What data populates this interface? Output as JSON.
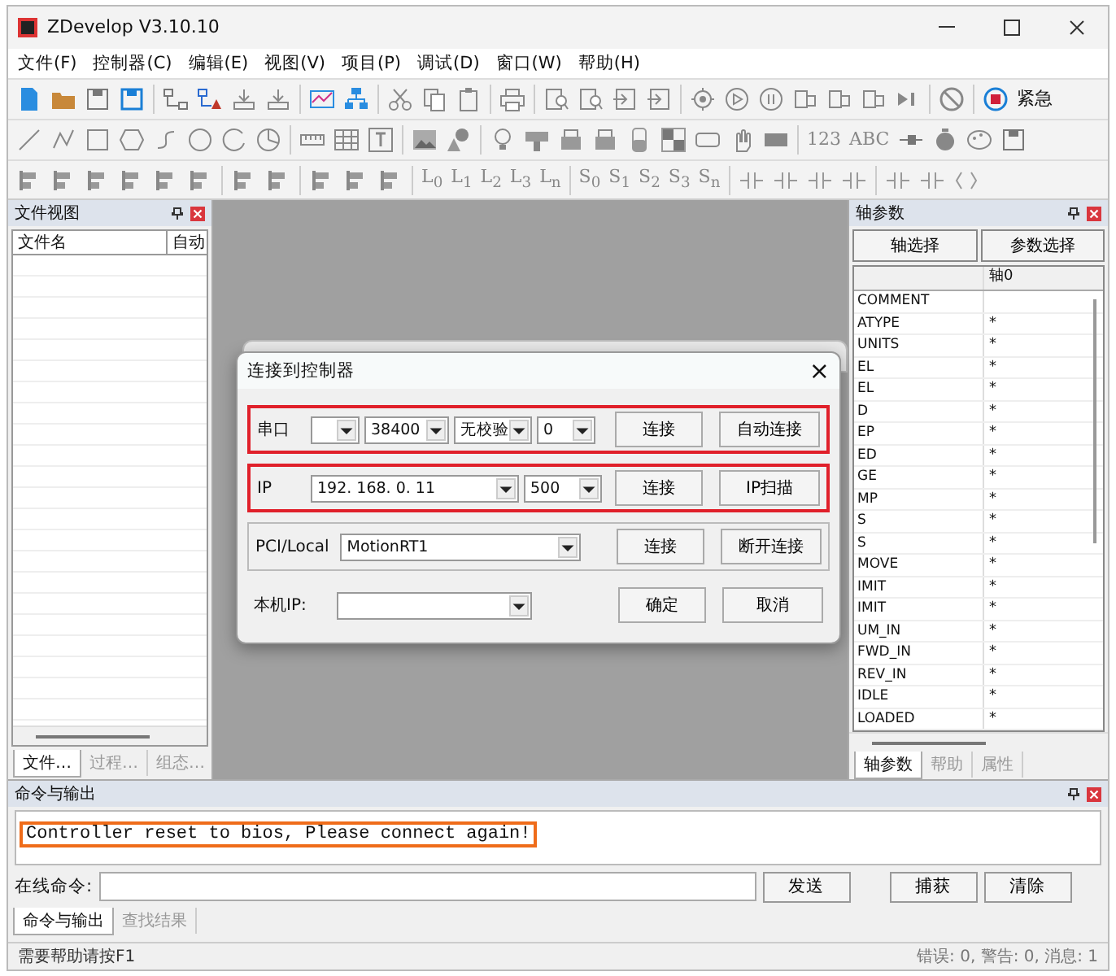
{
  "window": {
    "title": "ZDevelop V3.10.10"
  },
  "menu": [
    "文件(F)",
    "控制器(C)",
    "编辑(E)",
    "视图(V)",
    "项目(P)",
    "调试(D)",
    "窗口(W)",
    "帮助(H)"
  ],
  "toolbar": {
    "estop_label": "紧急",
    "row2_texts": [
      "123",
      "ABC"
    ],
    "row3_l_texts": [
      "L$_{0}$",
      "L$_{1}$",
      "L$_{2}$",
      "L$_{3}$",
      "L$_{n}$"
    ],
    "row3_s_texts": [
      "S$_{0}$",
      "S$_{1}$",
      "S$_{2}$",
      "S$_{3}$",
      "S$_{n}$"
    ]
  },
  "file_view": {
    "title": "文件视图",
    "columns": [
      "文件名",
      "自动"
    ],
    "tabs": [
      {
        "label": "文件…",
        "selected": true
      },
      {
        "label": "过程…",
        "selected": false
      },
      {
        "label": "组态…",
        "selected": false
      }
    ]
  },
  "axis_params": {
    "title": "轴参数",
    "buttons": [
      "轴选择",
      "参数选择"
    ],
    "column": "轴0",
    "rows": [
      {
        "name": "COMMENT"
      },
      {
        "name": "ATYPE",
        "value": "*"
      },
      {
        "name": "UNITS",
        "value": "*"
      },
      {
        "name": "EL",
        "value": "*"
      },
      {
        "name": "EL",
        "value": "*"
      },
      {
        "name": "D",
        "value": "*"
      },
      {
        "name": "EP",
        "value": "*"
      },
      {
        "name": "ED",
        "value": "*"
      },
      {
        "name": "GE",
        "value": "*"
      },
      {
        "name": "MP",
        "value": "*"
      },
      {
        "name": "S",
        "value": "*"
      },
      {
        "name": "S",
        "value": "*"
      },
      {
        "name": "MOVE",
        "value": "*"
      },
      {
        "name": "IMIT",
        "value": "*"
      },
      {
        "name": "IMIT",
        "value": "*"
      },
      {
        "name": "UM_IN",
        "value": "*"
      },
      {
        "name": "FWD_IN",
        "value": "*"
      },
      {
        "name": "REV_IN",
        "value": "*"
      },
      {
        "name": "IDLE",
        "value": "*"
      },
      {
        "name": "LOADED",
        "value": "*"
      }
    ],
    "tabs": [
      {
        "label": "轴参数",
        "selected": true
      },
      {
        "label": "帮助",
        "selected": false
      },
      {
        "label": "属性",
        "selected": false
      }
    ]
  },
  "dialog": {
    "title": "连接到控制器",
    "close": "×",
    "rows": [
      {
        "kind": "framed",
        "label": "串口",
        "highlighted": true,
        "selects": [
          {
            "kind": "dropdown"
          },
          {
            "value": "38400"
          },
          {
            "value": "无校验"
          },
          {
            "value": "0"
          }
        ],
        "buttons": [
          "连接",
          "自动连接"
        ]
      },
      {
        "kind": "framed",
        "label": "IP",
        "highlighted": true,
        "selects": [
          {
            "value": "192. 168. 0. 11"
          },
          {
            "value": "500"
          }
        ],
        "buttons": [
          "连接",
          "IP扫描"
        ]
      },
      {
        "kind": "group",
        "label": "PCI/Local",
        "selects": [
          {
            "value": "MotionRT1"
          }
        ],
        "buttons": [
          "连接",
          "断开连接"
        ]
      },
      {
        "kind": "plain",
        "label": "本机IP:",
        "selects": [
          {
            "kind": "dropdown"
          }
        ],
        "buttons": [
          "确定",
          "取消"
        ]
      }
    ]
  },
  "output": {
    "title": "命令与输出",
    "lines": [
      {
        "text": "Controller reset to bios, Please connect again!",
        "highlighted": true
      }
    ],
    "command_label": "在线命令:",
    "buttons": [
      "发送",
      "捕获",
      "清除"
    ],
    "tabs": [
      {
        "label": "命令与输出",
        "selected": true
      },
      {
        "label": "查找结果",
        "selected": false
      }
    ]
  },
  "status_bar": {
    "hint": "需要帮助请按F1",
    "counts": "错误: 0, 警告: 0, 消息: 1"
  }
}
